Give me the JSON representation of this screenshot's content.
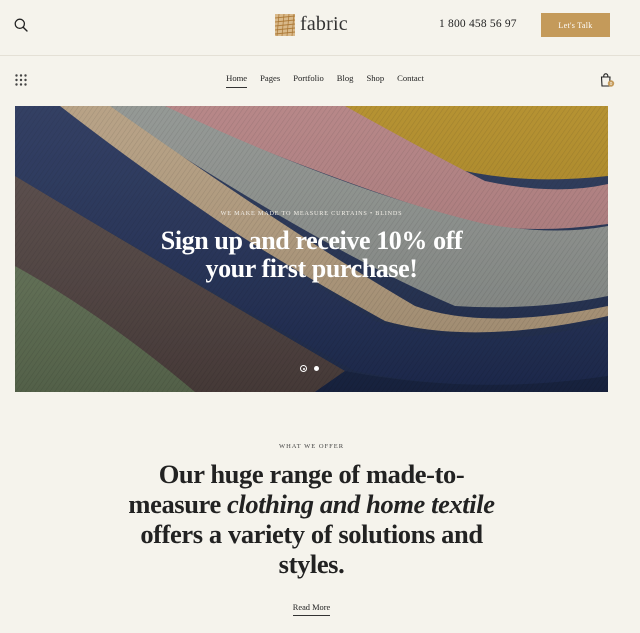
{
  "header": {
    "logo_text": "fabric",
    "phone": "1 800 458 56 97",
    "cta_label": "Let's Talk"
  },
  "nav": {
    "items": [
      {
        "label": "Home",
        "active": true
      },
      {
        "label": "Pages",
        "active": false
      },
      {
        "label": "Portfolio",
        "active": false
      },
      {
        "label": "Blog",
        "active": false
      },
      {
        "label": "Shop",
        "active": false
      },
      {
        "label": "Contact",
        "active": false
      }
    ],
    "cart_count": "0"
  },
  "hero": {
    "eyebrow": "We make made to measure curtains • blinds",
    "title_line1": "Sign up and receive 10% off",
    "title_line2": "your first purchase!",
    "slides": 2,
    "active_slide": 1
  },
  "offer": {
    "eyebrow": "What we offer",
    "line1": "Our huge range of made-to-",
    "line2_plain": "measure ",
    "line2_italic": "clothing and home textile",
    "line3": "offers a variety of solutions and",
    "line4": "styles.",
    "read_more": "Read More"
  },
  "colors": {
    "background": "#f5f3ec",
    "accent": "#c49a5a",
    "text": "#222222"
  }
}
